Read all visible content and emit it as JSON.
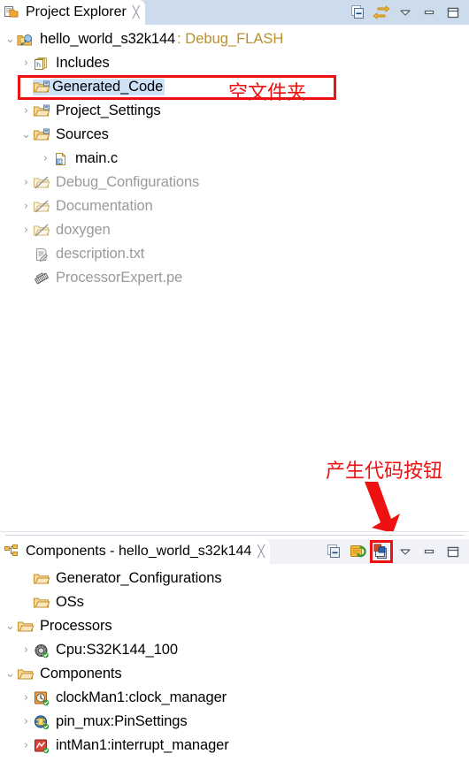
{
  "project_explorer": {
    "tab_label": "Project Explorer",
    "tab_icon": "project-explorer-icon",
    "close_glyph": "╳",
    "toolbar": [
      {
        "name": "collapse-all-button",
        "title": "Collapse All"
      },
      {
        "name": "link-with-editor-button",
        "title": "Link with Editor"
      },
      {
        "name": "view-menu-button",
        "title": "View Menu"
      },
      {
        "name": "minimize-button",
        "title": "Minimize"
      },
      {
        "name": "maximize-button",
        "title": "Maximize"
      }
    ],
    "tree": [
      {
        "indent": 0,
        "twisty": "⌄",
        "icon": "project-icon",
        "label": "hello_world_s32k144",
        "suffix": ": Debug_FLASH",
        "muted": false,
        "selected": false
      },
      {
        "indent": 1,
        "twisty": "›",
        "icon": "includes-icon",
        "label": "Includes",
        "suffix": "",
        "muted": false,
        "selected": false
      },
      {
        "indent": 1,
        "twisty": "",
        "icon": "folder-source-icon",
        "label": "Generated_Code",
        "suffix": "",
        "muted": false,
        "selected": true
      },
      {
        "indent": 1,
        "twisty": "›",
        "icon": "folder-source-icon",
        "label": "Project_Settings",
        "suffix": "",
        "muted": false,
        "selected": false
      },
      {
        "indent": 1,
        "twisty": "⌄",
        "icon": "folder-source-icon",
        "label": "Sources",
        "suffix": "",
        "muted": false,
        "selected": false
      },
      {
        "indent": 2,
        "twisty": "›",
        "icon": "c-file-icon",
        "label": "main.c",
        "suffix": "",
        "muted": false,
        "selected": false
      },
      {
        "indent": 1,
        "twisty": "›",
        "icon": "folder-excluded-icon",
        "label": "Debug_Configurations",
        "suffix": "",
        "muted": true,
        "selected": false
      },
      {
        "indent": 1,
        "twisty": "›",
        "icon": "folder-excluded-icon",
        "label": "Documentation",
        "suffix": "",
        "muted": true,
        "selected": false
      },
      {
        "indent": 1,
        "twisty": "›",
        "icon": "folder-excluded-icon",
        "label": "doxygen",
        "suffix": "",
        "muted": true,
        "selected": false
      },
      {
        "indent": 1,
        "twisty": "",
        "icon": "text-file-icon",
        "label": "description.txt",
        "suffix": "",
        "muted": true,
        "selected": false
      },
      {
        "indent": 1,
        "twisty": "",
        "icon": "pe-file-icon",
        "label": "ProcessorExpert.pe",
        "suffix": "",
        "muted": true,
        "selected": false
      }
    ]
  },
  "components_view": {
    "tab_label": "Components - hello_world_s32k144",
    "tab_icon": "components-view-icon",
    "close_glyph": "╳",
    "toolbar": [
      {
        "name": "collapse-all-button",
        "title": "Collapse All"
      },
      {
        "name": "refresh-button",
        "title": "Refresh"
      },
      {
        "name": "generate-processor-expert-code-button",
        "title": "Generate Processor Expert Code"
      },
      {
        "name": "view-menu-button",
        "title": "View Menu"
      },
      {
        "name": "minimize-button",
        "title": "Minimize"
      },
      {
        "name": "maximize-button",
        "title": "Maximize"
      }
    ],
    "tree": [
      {
        "indent": 1,
        "twisty": "",
        "icon": "folder-open-icon",
        "label": "Generator_Configurations"
      },
      {
        "indent": 1,
        "twisty": "",
        "icon": "folder-open-icon",
        "label": "OSs"
      },
      {
        "indent": 0,
        "twisty": "⌄",
        "icon": "folder-open-icon",
        "label": "Processors"
      },
      {
        "indent": 1,
        "twisty": "›",
        "icon": "cpu-icon",
        "label": "Cpu:S32K144_100"
      },
      {
        "indent": 0,
        "twisty": "⌄",
        "icon": "folder-open-icon",
        "label": "Components"
      },
      {
        "indent": 1,
        "twisty": "›",
        "icon": "clock-manager-icon",
        "label": "clockMan1:clock_manager"
      },
      {
        "indent": 1,
        "twisty": "›",
        "icon": "pin-settings-icon",
        "label": "pin_mux:PinSettings"
      },
      {
        "indent": 1,
        "twisty": "›",
        "icon": "interrupt-manager-icon",
        "label": "intMan1:interrupt_manager"
      }
    ]
  },
  "annotations": {
    "empty_folder_note": "空文件夹",
    "generate_code_note": "产生代码按钮",
    "accent_color": "#ee1111",
    "selection_color": "#cde2f7",
    "titlebar_color": "#ccdcec"
  }
}
